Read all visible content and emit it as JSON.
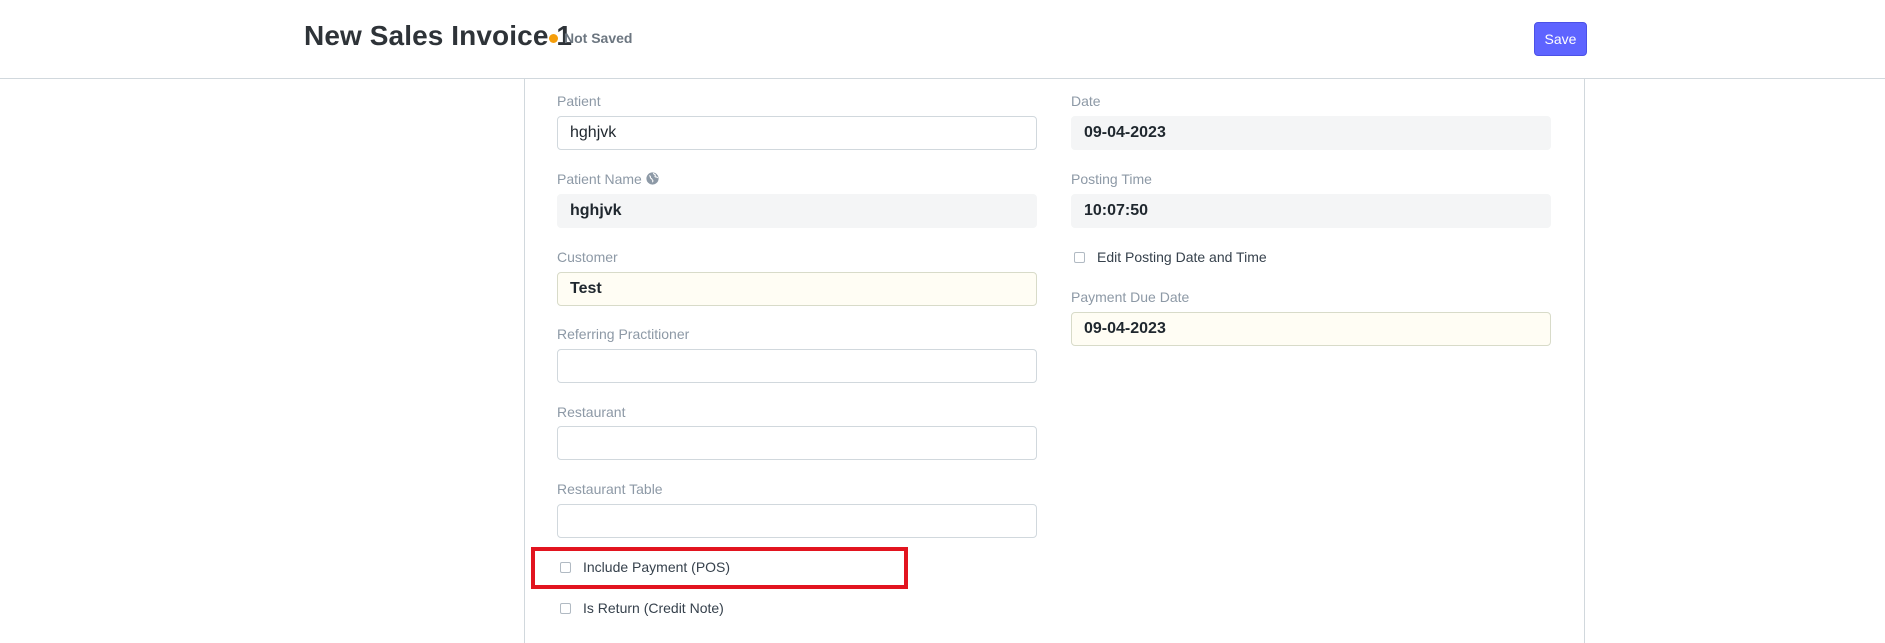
{
  "header": {
    "title": "New Sales Invoice 1",
    "status": "Not Saved",
    "save_label": "Save"
  },
  "form": {
    "left": {
      "patient": {
        "label": "Patient",
        "value": "hghjvk"
      },
      "patient_name": {
        "label": "Patient Name",
        "value": "hghjvk",
        "icon": "globe-icon"
      },
      "customer": {
        "label": "Customer",
        "value": "Test"
      },
      "referring_practitioner": {
        "label": "Referring Practitioner",
        "value": ""
      },
      "restaurant": {
        "label": "Restaurant",
        "value": ""
      },
      "restaurant_table": {
        "label": "Restaurant Table",
        "value": ""
      },
      "include_payment": {
        "label": "Include Payment (POS)",
        "checked": false
      },
      "is_return": {
        "label": "Is Return (Credit Note)",
        "checked": false
      }
    },
    "right": {
      "date": {
        "label": "Date",
        "value": "09-04-2023"
      },
      "posting_time": {
        "label": "Posting Time",
        "value": "10:07:50"
      },
      "edit_posting": {
        "label": "Edit Posting Date and Time",
        "checked": false
      },
      "payment_due_date": {
        "label": "Payment Due Date",
        "value": "09-04-2023"
      }
    }
  },
  "colors": {
    "primary": "#5e64ff",
    "status_dot": "#f59e0b",
    "highlight": "#e2141f"
  }
}
